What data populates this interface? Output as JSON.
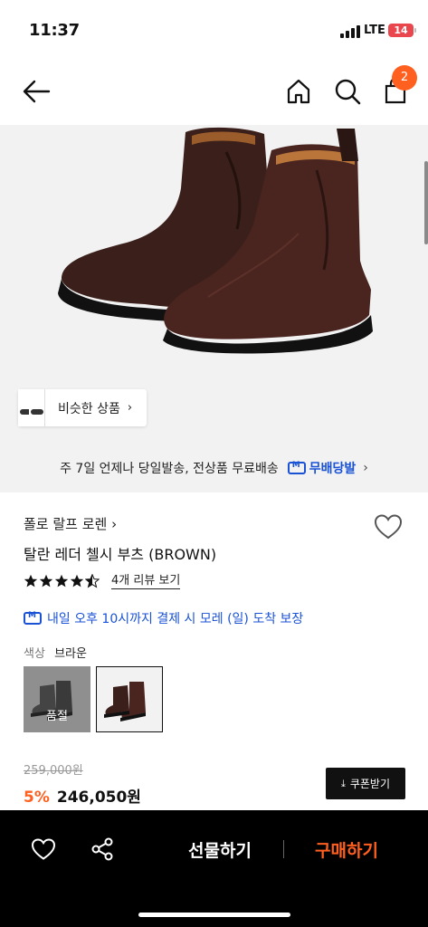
{
  "status_bar": {
    "time": "11:37",
    "network": "LTE",
    "battery": "14"
  },
  "nav": {
    "cart_count": "2"
  },
  "hero": {
    "similar_label": "비슷한 상품"
  },
  "delivery_banner": {
    "text": "주 7일 언제나 당일발송, 전상품 무료배송",
    "brand": "무배당발"
  },
  "product": {
    "brand": "폴로 랄프 로렌",
    "name": "탈란 레더 첼시 부츠 (BROWN)",
    "rating": 4.5,
    "review_link": "4개 리뷰 보기",
    "guarantee": "내일 오후 10시까지 결제 시 모레 (일) 도착 보장",
    "color_label": "색상",
    "color_value": "브라운",
    "soldout_label": "품절",
    "original_price": "259,000원",
    "discount": "5%",
    "price": "246,050원",
    "coupon_label": "쿠폰받기"
  },
  "bottom_bar": {
    "gift_label": "선물하기",
    "buy_label": "구매하기"
  },
  "colors": {
    "accent": "#ff5f1f",
    "delivery_blue": "#1a52d6",
    "battery": "#e9474d"
  },
  "icons": [
    "back-arrow-icon",
    "home-icon",
    "search-icon",
    "shopping-bag-icon",
    "chevron-right-icon",
    "heart-icon",
    "star-icon",
    "delivery-icon",
    "download-icon",
    "share-icon"
  ]
}
